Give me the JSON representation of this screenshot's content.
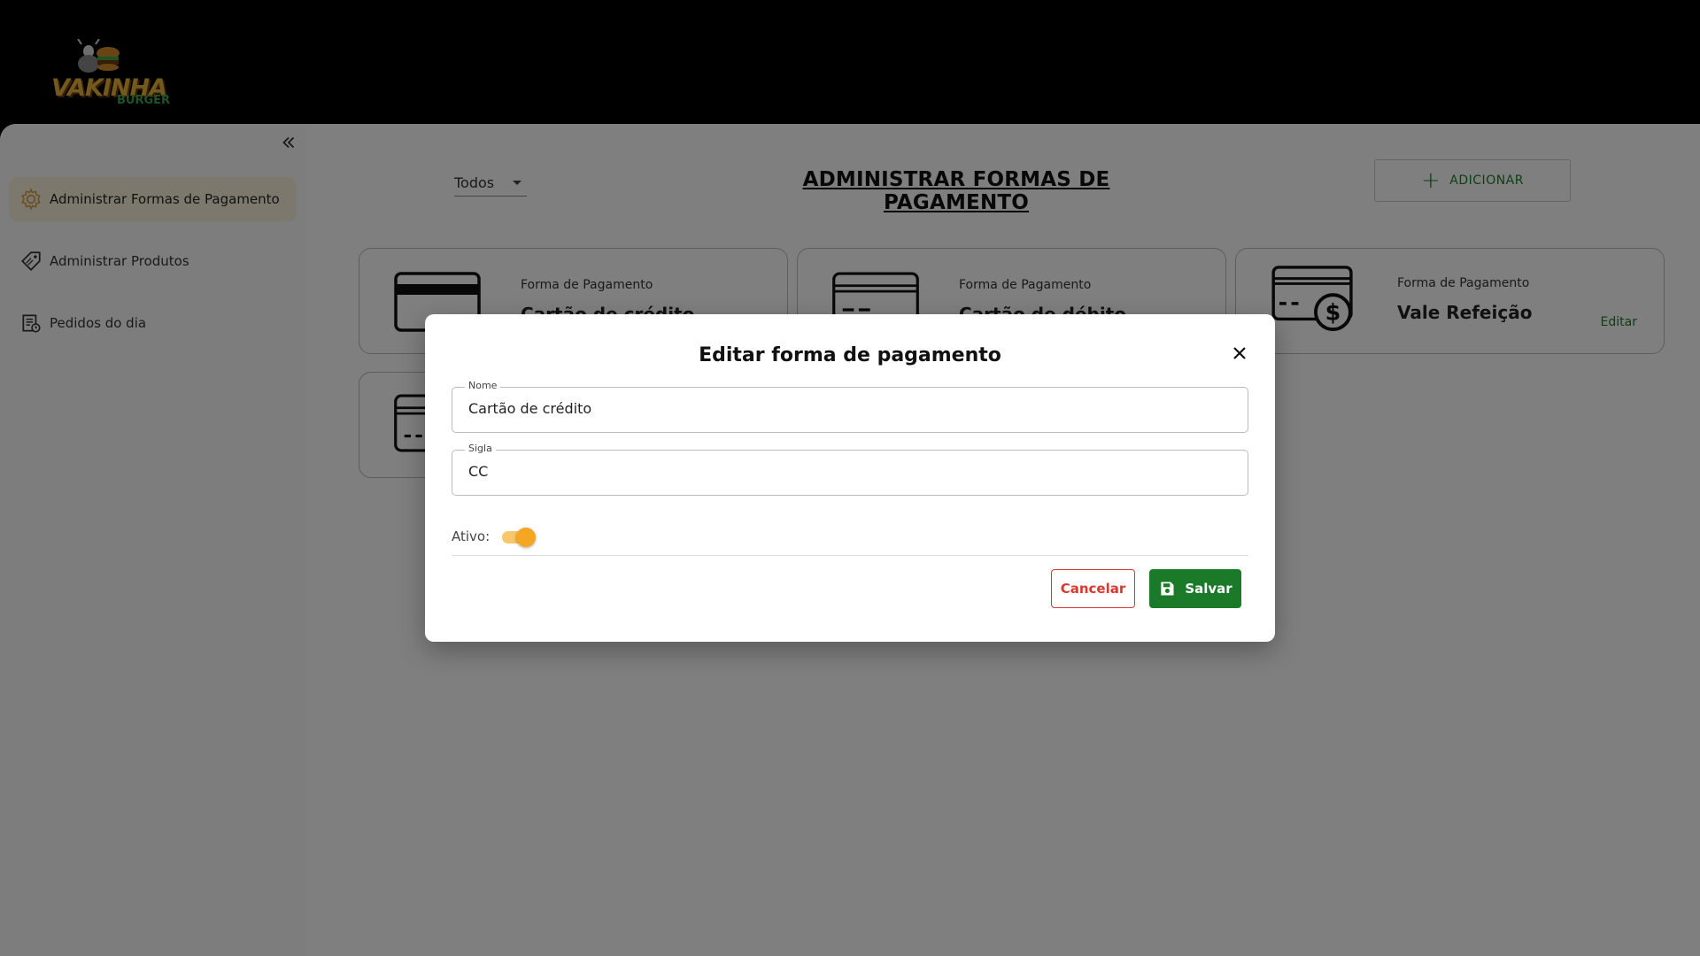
{
  "brand": {
    "logo_text": "VAKINHA",
    "logo_sub": "BURGER"
  },
  "sidebar": {
    "collapse_icon": "double-chevron-left-icon",
    "items": [
      {
        "label": "Administrar Formas de Pagamento",
        "icon": "gear-icon",
        "active": true
      },
      {
        "label": "Administrar Produtos",
        "icon": "tag-icon",
        "active": false
      },
      {
        "label": "Pedidos do dia",
        "icon": "orders-list-icon",
        "active": false
      }
    ]
  },
  "main": {
    "filter_value": "Todos",
    "title": "ADMINISTRAR FORMAS DE PAGAMENTO",
    "add_label": "ADICIONAR",
    "cards": [
      {
        "caption": "Forma de Pagamento",
        "name": "Cartão de crédito",
        "icon": "credit-card-icon"
      },
      {
        "caption": "Forma de Pagamento",
        "name": "Cartão de débito",
        "icon": "debit-card-icon"
      },
      {
        "caption": "Forma de Pagamento",
        "name": "Vale Refeição",
        "edit_label": "Editar",
        "icon": "meal-voucher-icon"
      }
    ]
  },
  "modal": {
    "title": "Editar forma de pagamento",
    "fields": {
      "name_label": "Nome",
      "name_value": "Cartão de crédito",
      "sigla_label": "Sigla",
      "sigla_value": "CC"
    },
    "active_label": "Ativo:",
    "active": true,
    "cancel_label": "Cancelar",
    "save_label": "Salvar"
  },
  "colors": {
    "accent_green": "#1b7a27",
    "cancel_red": "#d9382e",
    "toggle_orange": "#f5a623",
    "active_nav_bg": "#fbf1dc"
  }
}
